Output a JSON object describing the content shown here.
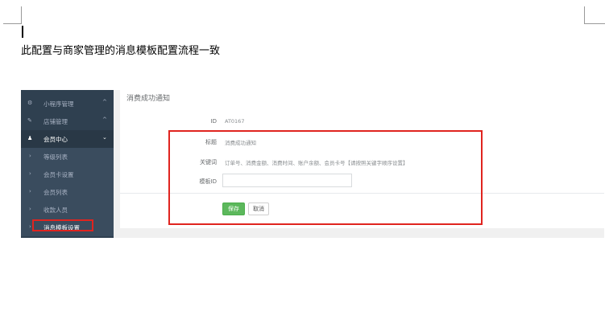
{
  "document": {
    "paragraph": "此配置与商家管理的消息模板配置流程一致"
  },
  "sidebar": {
    "items": [
      {
        "icon": "gear-icon",
        "glyph": "⚙",
        "label": "小程序管理",
        "chevron": "^"
      },
      {
        "icon": "wand-icon",
        "glyph": "✎",
        "label": "店铺管理",
        "chevron": "^"
      },
      {
        "icon": "user-icon",
        "glyph": "♟",
        "label": "会员中心",
        "chevron": "⌄"
      },
      {
        "icon": "chevron-right-icon",
        "glyph": "›",
        "label": "等级列表"
      },
      {
        "icon": "chevron-right-icon",
        "glyph": "›",
        "label": "会员卡设置"
      },
      {
        "icon": "chevron-right-icon",
        "glyph": "›",
        "label": "会员列表"
      },
      {
        "icon": "chevron-right-icon",
        "glyph": "›",
        "label": "收款人员"
      },
      {
        "icon": "chevron-right-icon",
        "glyph": "›",
        "label": "消息模板设置"
      }
    ]
  },
  "form": {
    "title": "消费成功通知",
    "id_label": "ID",
    "id_value": "AT0167",
    "heading_label": "标题",
    "heading_value": "消费成功通知",
    "keywords_label": "关键词",
    "keywords_value": "订单号、消费金额、消费时间、账户余额、会员卡号【请按照关键字顺序设置】",
    "template_id_label": "模板ID",
    "template_id_value": "",
    "save_label": "保存",
    "cancel_label": "取消"
  },
  "colors": {
    "sidebar_bg": "#2f4050",
    "highlight": "#e0241f",
    "save_button": "#5cb85c"
  }
}
